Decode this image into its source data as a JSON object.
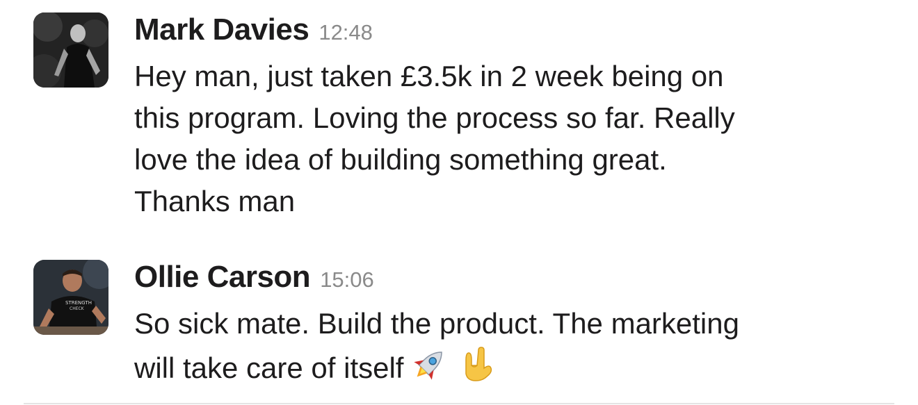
{
  "messages": [
    {
      "author": "Mark Davies",
      "time": "12:48",
      "lines": [
        "Hey man, just taken £3.5k in 2 week being on",
        "this program. Loving the process so far. Really",
        "love the idea of building something great.",
        "Thanks man"
      ]
    },
    {
      "author": "Ollie Carson",
      "time": "15:06",
      "lines": [
        "So sick mate. Build the product. The marketing",
        "will take care of itself"
      ],
      "emojis": [
        "rocket-emoji",
        "rock-on-hand-emoji"
      ]
    }
  ],
  "colors": {
    "text": "#1d1c1d",
    "timestamp": "#8a8a8a",
    "divider": "#e4e4e4"
  }
}
